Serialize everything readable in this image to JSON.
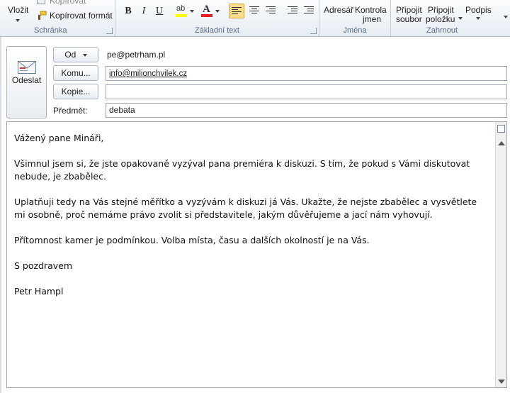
{
  "ribbon": {
    "clipboard": {
      "paste_label": "Vložit",
      "copy_label": "Kopírovat",
      "format_painter_label": "Kopírovat formát",
      "group_label": "Schránka"
    },
    "basic_text": {
      "bold": "B",
      "italic": "I",
      "underline": "U",
      "highlight": "ab",
      "font_color": "A",
      "group_label": "Základní text",
      "highlight_color": "#ffff00",
      "font_color_value": "#e02020"
    },
    "names": {
      "address_book_label": "Adresář",
      "check_names_line1": "Kontrola",
      "check_names_line2": "jmen",
      "group_label": "Jména"
    },
    "include": {
      "attach_file_line1": "Připojit",
      "attach_file_line2": "soubor",
      "attach_item_line1": "Připojit",
      "attach_item_line2": "položku",
      "signature_label": "Podpis",
      "group_label": "Zahrnout"
    }
  },
  "compose": {
    "send_label": "Odeslat",
    "from_label": "Od",
    "from_value": "pe@petrham.pl",
    "to_label": "Komu...",
    "to_value": "info@milionchvilek.cz",
    "cc_label": "Kopie...",
    "cc_value": "",
    "subject_label": "Předmět:",
    "subject_value": "debata"
  },
  "message": {
    "paragraphs": [
      "Vážený pane Mináři,",
      "Všimnul jsem si, že jste opakovaně vyzýval pana premiéra k diskuzi. S tím, že pokud s Vámi diskutovat nebude, je zbabělec.",
      "Uplatňuji tedy na Vás stejné měřítko a vyzývám k diskuzi já Vás. Ukažte, že nejste zbabělec a vysvětlete mi osobně, proč nemáme právo zvolit si představitele, jakým důvěřujeme a jací nám vyhovují.",
      "Přítomnost kamer je podmínkou. Volba místa, času a dalších okolností je na Vás.",
      "S pozdravem",
      "Petr Hampl"
    ]
  },
  "colors": {
    "accent_active": "#fbdc8c",
    "ribbon_label": "#5a6b82"
  }
}
